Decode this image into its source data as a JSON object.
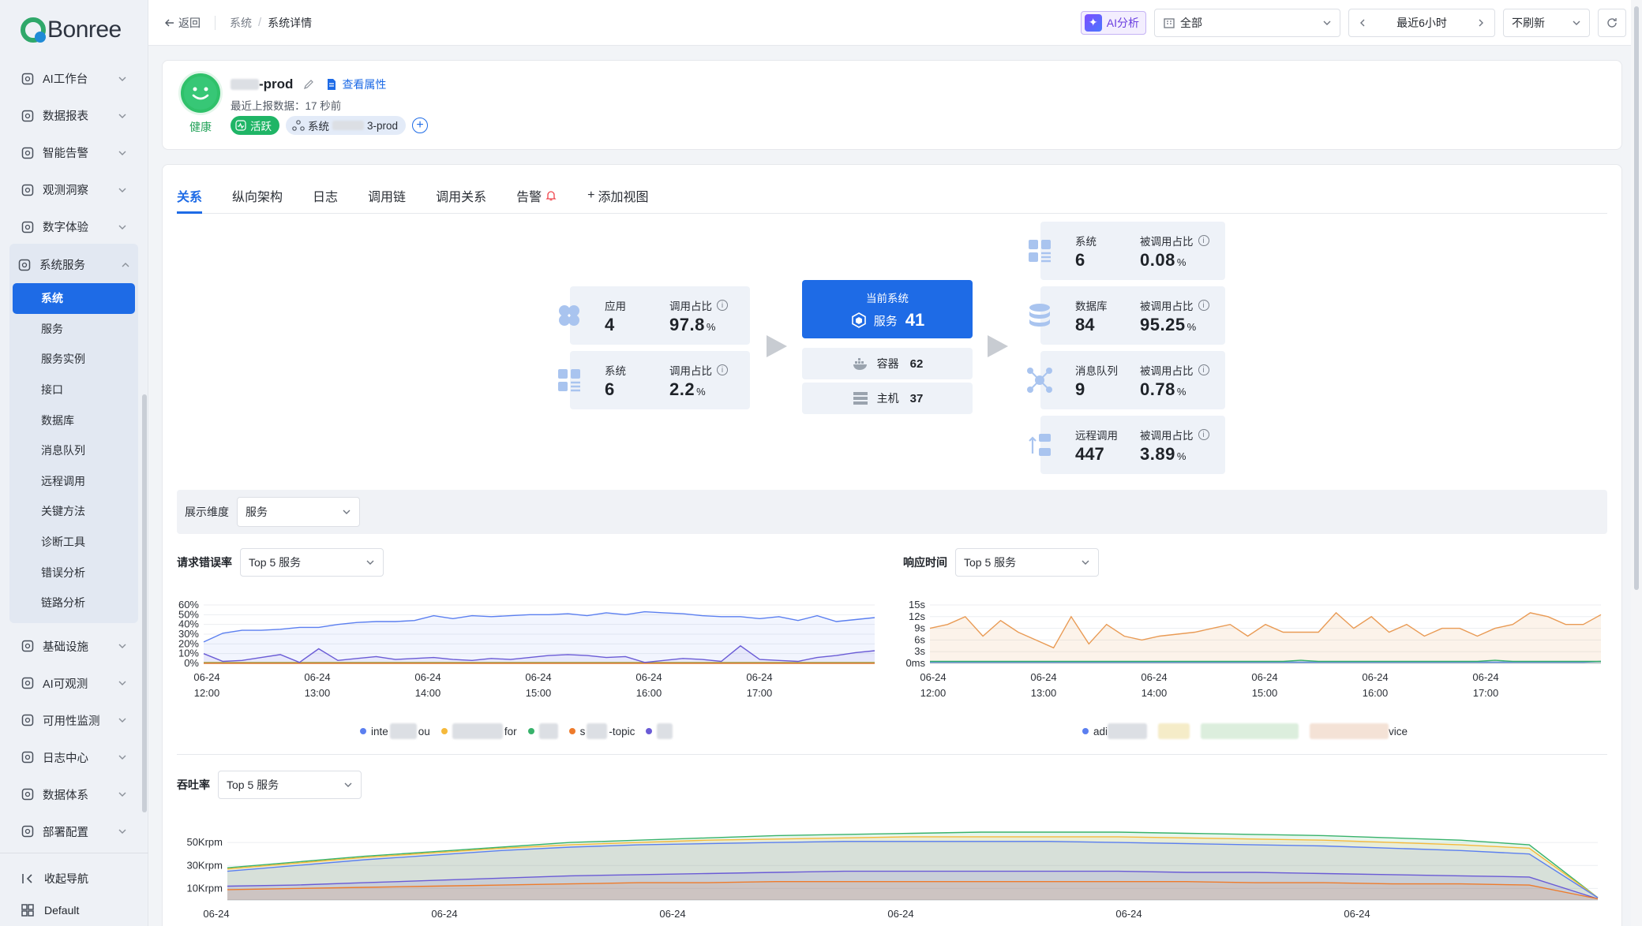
{
  "sidebar": {
    "brand": "Bonree",
    "items": [
      {
        "label": "AI工作台",
        "icon": "ai-workbench-icon"
      },
      {
        "label": "数据报表",
        "icon": "report-icon"
      },
      {
        "label": "智能告警",
        "icon": "alert-icon"
      },
      {
        "label": "观测洞察",
        "icon": "insight-icon"
      },
      {
        "label": "数字体验",
        "icon": "user-experience-icon"
      }
    ],
    "system_service": {
      "label": "系统服务",
      "children": [
        "系统",
        "服务",
        "服务实例",
        "接口",
        "数据库",
        "消息队列",
        "远程调用",
        "关键方法",
        "诊断工具",
        "错误分析",
        "链路分析"
      ],
      "active_index": 0
    },
    "items_after": [
      {
        "label": "基础设施",
        "icon": "infrastructure-icon"
      },
      {
        "label": "AI可观测",
        "icon": "ai-observe-icon"
      },
      {
        "label": "可用性监测",
        "icon": "availability-icon"
      },
      {
        "label": "日志中心",
        "icon": "log-icon"
      },
      {
        "label": "数据体系",
        "icon": "data-system-icon"
      },
      {
        "label": "部署配置",
        "icon": "deploy-icon"
      }
    ],
    "footer": {
      "collapse": "收起导航",
      "workspace": "Default"
    }
  },
  "topbar": {
    "back": "返回",
    "crumbs": [
      "系统",
      "系统详情"
    ],
    "ai_button": "AI分析",
    "scope_select": "全部",
    "time_range": "最近6小时",
    "refresh_select": "不刷新"
  },
  "header": {
    "health_label": "健康",
    "name_suffix": "-prod",
    "view_attributes": "查看属性",
    "last_report": "最近上报数据：17 秒前",
    "tag_active": "活跃",
    "tag_system_prefix": "系统",
    "tag_system_suffix": "3-prod"
  },
  "tabs": [
    "关系",
    "纵向架构",
    "日志",
    "调用链",
    "调用关系",
    "告警",
    "添加视图"
  ],
  "topology": {
    "upstream": [
      {
        "name": "应用",
        "count": "4",
        "ratio_label": "调用占比",
        "ratio": "97.8",
        "unit": "%"
      },
      {
        "name": "系统",
        "count": "6",
        "ratio_label": "调用占比",
        "ratio": "2.2",
        "unit": "%"
      }
    ],
    "current": {
      "title": "当前系统",
      "service_label": "服务",
      "service_count": "41",
      "container_label": "容器",
      "container_count": "62",
      "host_label": "主机",
      "host_count": "37"
    },
    "downstream": [
      {
        "name": "系统",
        "count": "6",
        "ratio_label": "被调用占比",
        "ratio": "0.08",
        "unit": "%"
      },
      {
        "name": "数据库",
        "count": "84",
        "ratio_label": "被调用占比",
        "ratio": "95.25",
        "unit": "%"
      },
      {
        "name": "消息队列",
        "count": "9",
        "ratio_label": "被调用占比",
        "ratio": "0.78",
        "unit": "%"
      },
      {
        "name": "远程调用",
        "count": "447",
        "ratio_label": "被调用占比",
        "ratio": "3.89",
        "unit": "%"
      }
    ]
  },
  "dimension": {
    "label": "展示维度",
    "value": "服务"
  },
  "charts": {
    "error_rate": {
      "title": "请求错误率",
      "select": "Top 5 服务",
      "legend": [
        "inte",
        "ou",
        "for",
        "",
        "s",
        "-topic",
        ""
      ]
    },
    "response_time": {
      "title": "响应时间",
      "select": "Top 5 服务",
      "legend": [
        "adi",
        "vice"
      ]
    },
    "throughput": {
      "title": "吞吐率",
      "select": "Top 5 服务"
    }
  },
  "chart_data": [
    {
      "type": "line",
      "title": "请求错误率",
      "x": [
        "06-24 12:00",
        "06-24 13:00",
        "06-24 14:00",
        "06-24 15:00",
        "06-24 16:00",
        "06-24 17:00"
      ],
      "yticks": [
        "60%",
        "50%",
        "40%",
        "30%",
        "20%",
        "10%",
        "0%"
      ],
      "ylim": [
        0,
        60
      ],
      "series": [
        {
          "color": "#5b7ff0",
          "values": [
            22,
            31,
            34,
            34,
            35,
            37,
            37,
            40,
            42,
            43,
            43,
            44,
            49,
            46,
            49,
            48,
            49,
            50,
            50,
            51,
            49,
            52,
            50,
            53,
            52,
            51,
            49,
            48,
            48,
            46,
            48,
            44,
            49,
            43,
            45,
            47
          ]
        },
        {
          "color": "#f5b93b",
          "values": [
            1,
            1,
            1,
            1,
            1,
            1,
            1,
            1,
            1,
            1,
            1,
            1,
            1,
            1,
            1,
            1,
            1,
            1,
            1,
            1,
            1,
            1,
            1,
            1,
            1,
            1,
            1,
            1,
            1,
            1,
            1,
            1,
            1,
            1,
            1,
            1
          ]
        },
        {
          "color": "#38b26b",
          "values": [
            0.5,
            0.5,
            0.5,
            0.5,
            0.5,
            0.5,
            0.5,
            0.5,
            0.5,
            0.5,
            0.5,
            0.5,
            0.5,
            0.5,
            0.5,
            0.5,
            0.5,
            0.5,
            0.5,
            0.5,
            0.5,
            0.5,
            0.5,
            0.5,
            0.5,
            0.5,
            0.5,
            0.5,
            0.5,
            0.5,
            0.5,
            0.5,
            0.5,
            0.5,
            0.5,
            0.5
          ]
        },
        {
          "color": "#ee7b2b",
          "values": [
            0,
            0,
            0,
            0,
            0,
            0,
            0,
            0,
            0,
            0,
            0,
            0,
            0,
            0,
            0,
            0,
            0,
            0,
            0,
            0,
            0,
            0,
            0,
            0,
            0,
            0,
            0,
            0,
            0,
            0,
            0,
            0,
            0,
            0,
            0,
            0
          ]
        },
        {
          "color": "#6a5bd6",
          "values": [
            10,
            2,
            3,
            6,
            9,
            1,
            15,
            3,
            5,
            7,
            4,
            5,
            6,
            4,
            3,
            5,
            4,
            6,
            8,
            9,
            8,
            6,
            7,
            1,
            3,
            5,
            4,
            2,
            18,
            4,
            3,
            2,
            6,
            8,
            11,
            13
          ]
        }
      ]
    },
    {
      "type": "line",
      "title": "响应时间",
      "x": [
        "06-24 12:00",
        "06-24 13:00",
        "06-24 14:00",
        "06-24 15:00",
        "06-24 16:00",
        "06-24 17:00"
      ],
      "yticks": [
        "15s",
        "12s",
        "9s",
        "6s",
        "3s",
        "0ms"
      ],
      "ylim": [
        0,
        15
      ],
      "series": [
        {
          "color": "#e99b55",
          "values": [
            9,
            10,
            12,
            7,
            11,
            8,
            6,
            4,
            12,
            5,
            10,
            7,
            6,
            7,
            7.5,
            8,
            9,
            10,
            7,
            10,
            8,
            8,
            8,
            13,
            9,
            12,
            8,
            10,
            7,
            9,
            9,
            7,
            9,
            10,
            13,
            12,
            10,
            10,
            12.5
          ]
        },
        {
          "color": "#5b7ff0",
          "values": [
            0.3,
            0.3,
            0.3,
            0.3,
            0.3,
            0.3,
            0.3,
            0.3,
            0.3,
            0.3,
            0.3,
            0.3,
            0.3,
            0.3,
            0.3,
            0.3,
            0.3,
            0.3,
            0.3,
            0.3,
            0.3,
            0.3,
            0.3,
            0.3,
            0.3,
            0.3,
            0.3,
            0.3,
            0.3,
            0.3,
            0.3,
            0.3,
            0.3,
            0.3,
            0.3,
            0.3,
            0.3,
            0.3,
            0.5
          ]
        },
        {
          "color": "#38b26b",
          "values": [
            0.5,
            0.5,
            0.5,
            0.5,
            0.5,
            0.5,
            0.5,
            0.5,
            0.5,
            0.5,
            0.5,
            0.5,
            0.5,
            0.5,
            0.5,
            0.5,
            0.5,
            0.5,
            0.5,
            0.5,
            0.5,
            0.8,
            0.5,
            0.5,
            0.5,
            0.5,
            0.5,
            0.5,
            0.5,
            0.5,
            0.5,
            0.5,
            0.8,
            0.5,
            0.5,
            0.5,
            0.5,
            0.5,
            0.5
          ]
        }
      ]
    },
    {
      "type": "area",
      "title": "吞吐率",
      "x": [
        "06-24 12:00",
        "06-24 13:00",
        "06-24 14:00",
        "06-24 15:00",
        "06-24 16:00",
        "06-24 17:00"
      ],
      "yticks": [
        "50Krpm",
        "30Krpm",
        "10Krpm"
      ],
      "ylim": [
        0,
        70
      ],
      "series": [
        {
          "color": "#38b26b",
          "values": [
            28,
            33,
            38,
            42,
            46,
            50,
            52,
            54,
            56,
            57,
            58,
            59,
            59,
            59,
            58,
            57,
            56,
            54,
            52,
            48,
            2
          ]
        },
        {
          "color": "#f5b93b",
          "values": [
            27,
            32,
            37,
            41,
            45,
            48,
            50,
            52,
            53,
            54,
            55,
            55,
            55,
            55,
            54,
            53,
            52,
            50,
            48,
            45,
            2
          ]
        },
        {
          "color": "#5b7ff0",
          "values": [
            25,
            30,
            35,
            39,
            43,
            46,
            48,
            49,
            50,
            51,
            51,
            51,
            51,
            50,
            49,
            48,
            47,
            45,
            43,
            40,
            2
          ]
        },
        {
          "color": "#6a5bd6",
          "values": [
            12,
            13,
            15,
            17,
            19,
            21,
            22,
            23,
            24,
            25,
            25,
            25,
            25,
            25,
            24,
            24,
            23,
            22,
            21,
            20,
            1
          ]
        },
        {
          "color": "#ee7b2b",
          "values": [
            9,
            10,
            11,
            12,
            13,
            14,
            15,
            15,
            16,
            16,
            16,
            16,
            16,
            16,
            16,
            15,
            15,
            14,
            14,
            13,
            1
          ]
        }
      ]
    }
  ]
}
